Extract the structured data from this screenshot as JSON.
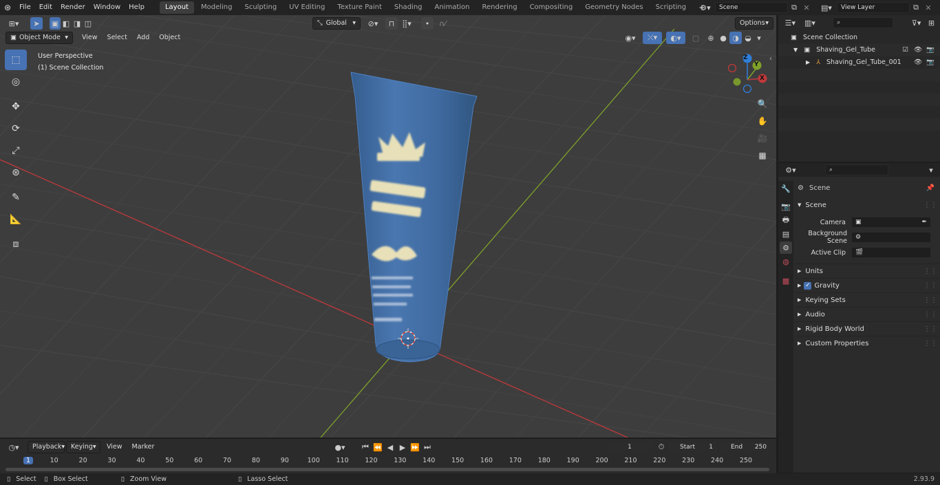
{
  "topbar": {
    "menus": [
      "File",
      "Edit",
      "Render",
      "Window",
      "Help"
    ],
    "workspaces": [
      "Layout",
      "Modeling",
      "Sculpting",
      "UV Editing",
      "Texture Paint",
      "Shading",
      "Animation",
      "Rendering",
      "Compositing",
      "Geometry Nodes",
      "Scripting"
    ],
    "active_workspace": "Layout",
    "add_tab": "+",
    "scene_name": "Scene",
    "view_layer": "View Layer"
  },
  "viewport": {
    "mode": "Object Mode",
    "menus": [
      "View",
      "Select",
      "Add",
      "Object"
    ],
    "transform_orientation": "Global",
    "options_label": "Options",
    "perspective_label": "User Perspective",
    "collection_label": "(1) Scene Collection",
    "gizmo_axes": {
      "x": "X",
      "y": "Y",
      "z": "Z"
    }
  },
  "outliner": {
    "root": "Scene Collection",
    "items": [
      {
        "label": "Shaving_Gel_Tube",
        "level": 1
      },
      {
        "label": "Shaving_Gel_Tube_001",
        "level": 2
      }
    ]
  },
  "properties": {
    "context_title": "Scene",
    "section": "Scene",
    "fields": [
      {
        "label": "Camera",
        "value": ""
      },
      {
        "label": "Background Scene",
        "value": ""
      },
      {
        "label": "Active Clip",
        "value": ""
      }
    ],
    "panels": [
      "Units",
      "Gravity",
      "Keying Sets",
      "Audio",
      "Rigid Body World",
      "Custom Properties"
    ],
    "gravity_checked": true
  },
  "timeline": {
    "menus": [
      "Playback",
      "Keying",
      "View",
      "Marker"
    ],
    "current_frame": "1",
    "start_label": "Start",
    "start_value": "1",
    "end_label": "End",
    "end_value": "250",
    "ticks": [
      "1",
      "10",
      "20",
      "30",
      "40",
      "50",
      "60",
      "70",
      "80",
      "90",
      "100",
      "110",
      "120",
      "130",
      "140",
      "150",
      "160",
      "170",
      "180",
      "190",
      "200",
      "210",
      "220",
      "230",
      "240",
      "250"
    ]
  },
  "statusbar": {
    "items": [
      "Select",
      "Box Select",
      "Zoom View",
      "Lasso Select"
    ],
    "version": "2.93.9"
  },
  "colors": {
    "accent": "#4772b3",
    "x_axis": "#c0393b",
    "y_axis": "#7fa12a",
    "z_axis": "#2f7fdc",
    "tube": "#3f6aa0"
  }
}
